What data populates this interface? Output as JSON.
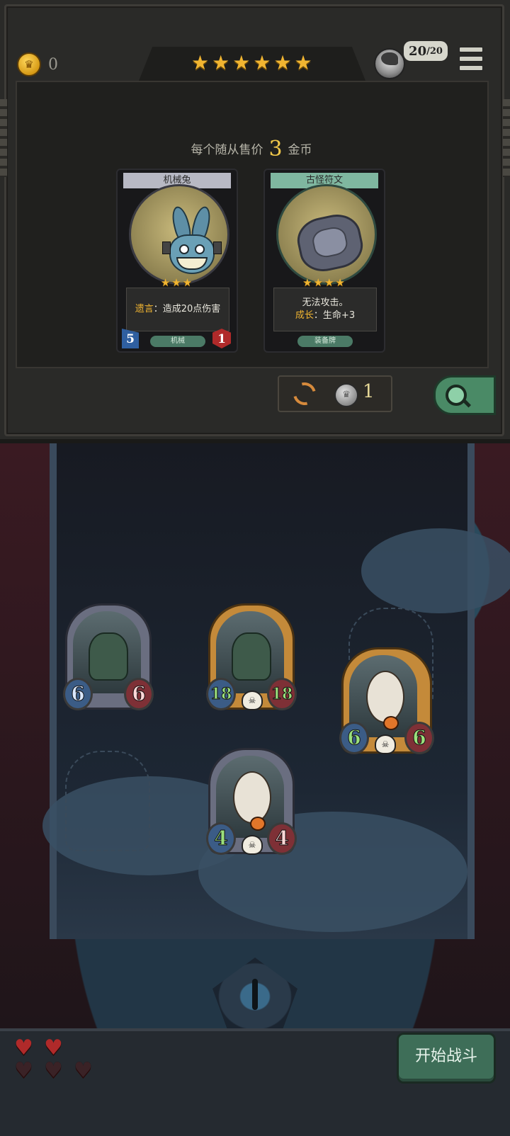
{
  "header": {
    "coins": "0",
    "tier_stars": [
      "★",
      "★",
      "★",
      "★",
      "★",
      "★"
    ],
    "hp_current": "20",
    "hp_max": "/20"
  },
  "shop": {
    "sell_prefix": "每个随从售价",
    "sell_price": "3",
    "sell_suffix": "金币",
    "cards": [
      {
        "name": "机械兔",
        "stars": "★★★",
        "effect_keyword": "遗言",
        "effect_text": "：造成20点伤害",
        "tag": "机械",
        "attack": "5",
        "health": "1"
      },
      {
        "name": "古怪符文",
        "stars": "★★★★",
        "effect_line1": "无法攻击。",
        "effect_keyword": "成长",
        "effect_text": "：生命+3",
        "tag": "装备牌"
      }
    ],
    "refresh_cost": "1"
  },
  "board": {
    "units": [
      {
        "attack": "6",
        "health": "6",
        "frame": "silver"
      },
      {
        "attack": "18",
        "health": "18",
        "frame": "gold"
      },
      {
        "attack": "6",
        "health": "6",
        "frame": "gold"
      },
      {
        "attack": "4",
        "health": "4",
        "frame": "silver"
      }
    ]
  },
  "footer": {
    "lives_full": 2,
    "lives_total": 5,
    "start_battle_label": "开始战斗"
  },
  "colors": {
    "gold": "#f1b531",
    "health_red": "#b02a2a",
    "attack_blue": "#3b5c86",
    "fight_green": "#3e6e58"
  }
}
